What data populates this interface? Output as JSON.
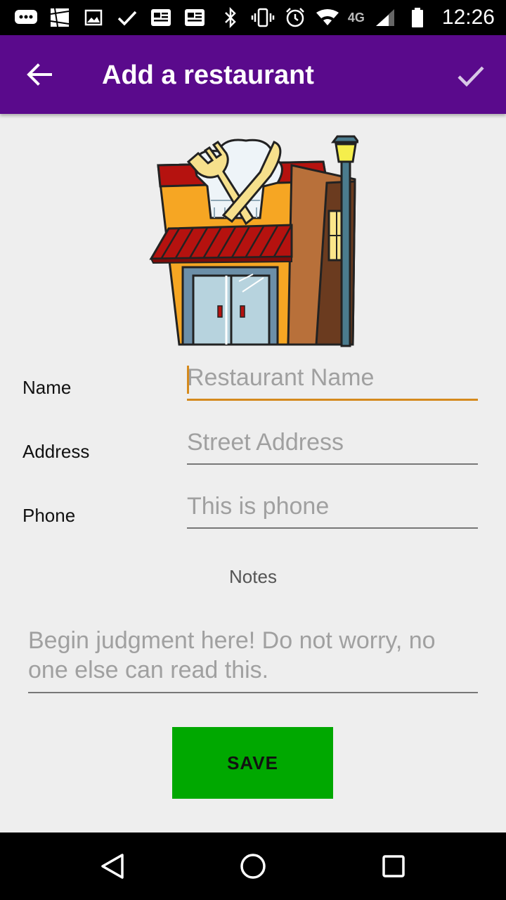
{
  "status_bar": {
    "time": "12:26",
    "network": "4G",
    "icons": [
      "messages-icon",
      "gallery-icon",
      "image-icon",
      "check-icon",
      "news-icon",
      "news-icon",
      "bluetooth-icon",
      "vibrate-icon",
      "alarm-icon",
      "wifi-icon",
      "signal-icon",
      "battery-icon"
    ]
  },
  "app_bar": {
    "title": "Add a restaurant",
    "back_icon": "arrow-left-icon",
    "confirm_icon": "check-icon",
    "background": "#5a0a8c"
  },
  "form": {
    "name": {
      "label": "Name",
      "value": "",
      "placeholder": "Restaurant Name"
    },
    "address": {
      "label": "Address",
      "value": "",
      "placeholder": "Street Address"
    },
    "phone": {
      "label": "Phone",
      "value": "",
      "placeholder": "This is phone"
    },
    "notes": {
      "label": "Notes",
      "value": "",
      "placeholder": "Begin judgment here! Do not worry, no one else can read this."
    },
    "focus_color": "#d58a1d"
  },
  "save_button": {
    "label": "SAVE",
    "color": "#00a800"
  },
  "nav_bar": {
    "icons": [
      "back-triangle-icon",
      "home-circle-icon",
      "recents-square-icon"
    ]
  }
}
